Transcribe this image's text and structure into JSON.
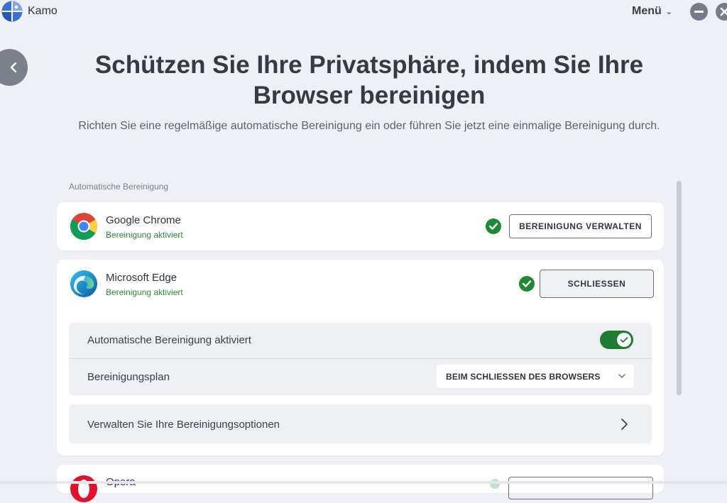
{
  "app": {
    "name": "Kamo",
    "menu_label": "Menü"
  },
  "page": {
    "title": "Schützen Sie Ihre Privatsphäre, indem Sie Ihre Browser bereinigen",
    "subtitle": "Richten Sie eine regelmäßige automatische Bereinigung ein oder führen Sie jetzt eine einmalige Bereinigung durch."
  },
  "section": {
    "label": "Automatische Bereinigung"
  },
  "browsers": [
    {
      "name": "Google Chrome",
      "status": "Bereinigung aktiviert",
      "button": "BEREINIGUNG VERWALTEN",
      "icon": "chrome-icon"
    },
    {
      "name": "Microsoft Edge",
      "status": "Bereinigung aktiviert",
      "button": "SCHLIESSEN",
      "icon": "edge-icon",
      "settings": {
        "auto_label": "Automatische Bereinigung aktiviert",
        "auto_enabled": true,
        "plan_label": "Bereinigungsplan",
        "plan_value": "BEIM SCHLIESSEN DES BROWSERS",
        "options_label": "Verwalten Sie Ihre Bereinigungsoptionen"
      }
    },
    {
      "name": "Opera",
      "icon": "opera-icon"
    }
  ],
  "colors": {
    "accent_green": "#1e8a36",
    "status_green": "#2e8a3c",
    "toggle_on": "#1e7d32"
  }
}
